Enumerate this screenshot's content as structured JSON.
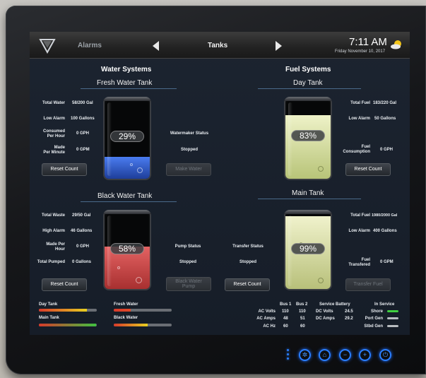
{
  "topbar": {
    "alarms_label": "Alarms",
    "title": "Tanks",
    "time": "7:11 AM",
    "date": "Friday November 10, 2017"
  },
  "water": {
    "section_title": "Water Systems",
    "fresh": {
      "title": "Fresh Water Tank",
      "total_water_label": "Total Water",
      "total_water_value": "58/200 Gal",
      "low_alarm_label": "Low Alarm",
      "low_alarm_value": "100 Gallons",
      "consumed_label_1": "Consumed",
      "consumed_label_2": "Per Hour",
      "consumed_value": "0 GPH",
      "made_label_1": "Made",
      "made_label_2": "Per Minute",
      "made_value": "0 GPM",
      "percent": "29%",
      "level": 0.29,
      "watermaker_label": "Watermaker Status",
      "watermaker_value": "Stopped",
      "reset_label": "Reset Count",
      "make_water_label": "Make Water"
    },
    "black": {
      "title": "Black Water Tank",
      "total_waste_label": "Total Waste",
      "total_waste_value": "29/50 Gal",
      "high_alarm_label": "High Alarm",
      "high_alarm_value": "46 Gallons",
      "made_label_1": "Made Per",
      "made_label_2": "Hour",
      "made_value": "0 GPH",
      "total_pumped_label": "Total Pumped",
      "total_pumped_value": "0 Gallons",
      "percent": "58%",
      "level": 0.58,
      "pump_status_label": "Pump Status",
      "pump_status_value": "Stopped",
      "transfer_status_label": "Transfer Status",
      "transfer_status_value": "Stopped",
      "reset_label": "Reset Count",
      "black_water_pump_label_1": "Black Water",
      "black_water_pump_label_2": "Pump"
    }
  },
  "fuel": {
    "section_title": "Fuel Systems",
    "day": {
      "title": "Day Tank",
      "total_fuel_label": "Total Fuel",
      "total_fuel_value": "183/220 Gal",
      "low_alarm_label": "Low Alarm",
      "low_alarm_value": "50 Gallons",
      "consumption_label_1": "Fuel",
      "consumption_label_2": "Consumption",
      "consumption_value": "0 GPH",
      "percent": "83%",
      "level": 0.83,
      "reset_label": "Reset Count"
    },
    "main": {
      "title": "Main Tank",
      "total_fuel_label": "Total Fuel",
      "total_fuel_value": "1980/2000 Gal",
      "low_alarm_label": "Low Alarm",
      "low_alarm_value": "400 Gallons",
      "transfered_label_1": "Fuel",
      "transfered_label_2": "Transfered",
      "transfered_value": "0 GPM",
      "percent": "99%",
      "level": 0.99,
      "reset_label": "Reset Count",
      "transfer_fuel_label": "Transfer Fuel"
    }
  },
  "summary_bars": [
    {
      "label": "Day Tank",
      "level": 0.83,
      "color": "#e8d020"
    },
    {
      "label": "Fresh Water",
      "level": 0.29,
      "color": "#e04a2a"
    },
    {
      "label": "Main Tank",
      "level": 0.99,
      "color": "#40c040"
    },
    {
      "label": "Black Water",
      "level": 0.58,
      "color": "#e8d020"
    }
  ],
  "electrical": {
    "bus1_header": "Bus 1",
    "bus2_header": "Bus 2",
    "service_battery_header": "Service Battery",
    "in_service_header": "In Service",
    "rows": [
      {
        "label": "AC Volts",
        "bus1": "110",
        "bus2": "110",
        "sb_label": "DC Volts",
        "sb_value": "24.5",
        "svc_label": "Shore",
        "svc_color": "#40d040"
      },
      {
        "label": "AC Amps",
        "bus1": "48",
        "bus2": "51",
        "sb_label": "DC Amps",
        "sb_value": "29.2",
        "svc_label": "Port Gen",
        "svc_color": "#b8bcc0"
      },
      {
        "label": "AC Hz",
        "bus1": "60",
        "bus2": "60",
        "sb_label": "",
        "sb_value": "",
        "svc_label": "Stbd Gen",
        "svc_color": "#b8bcc0"
      }
    ]
  },
  "colors": {
    "fresh_fill": "#2f5fd0",
    "black_fill": "#d04848",
    "fuel_fill": "#d8e0a0",
    "accent_blue": "#2a7fff"
  }
}
